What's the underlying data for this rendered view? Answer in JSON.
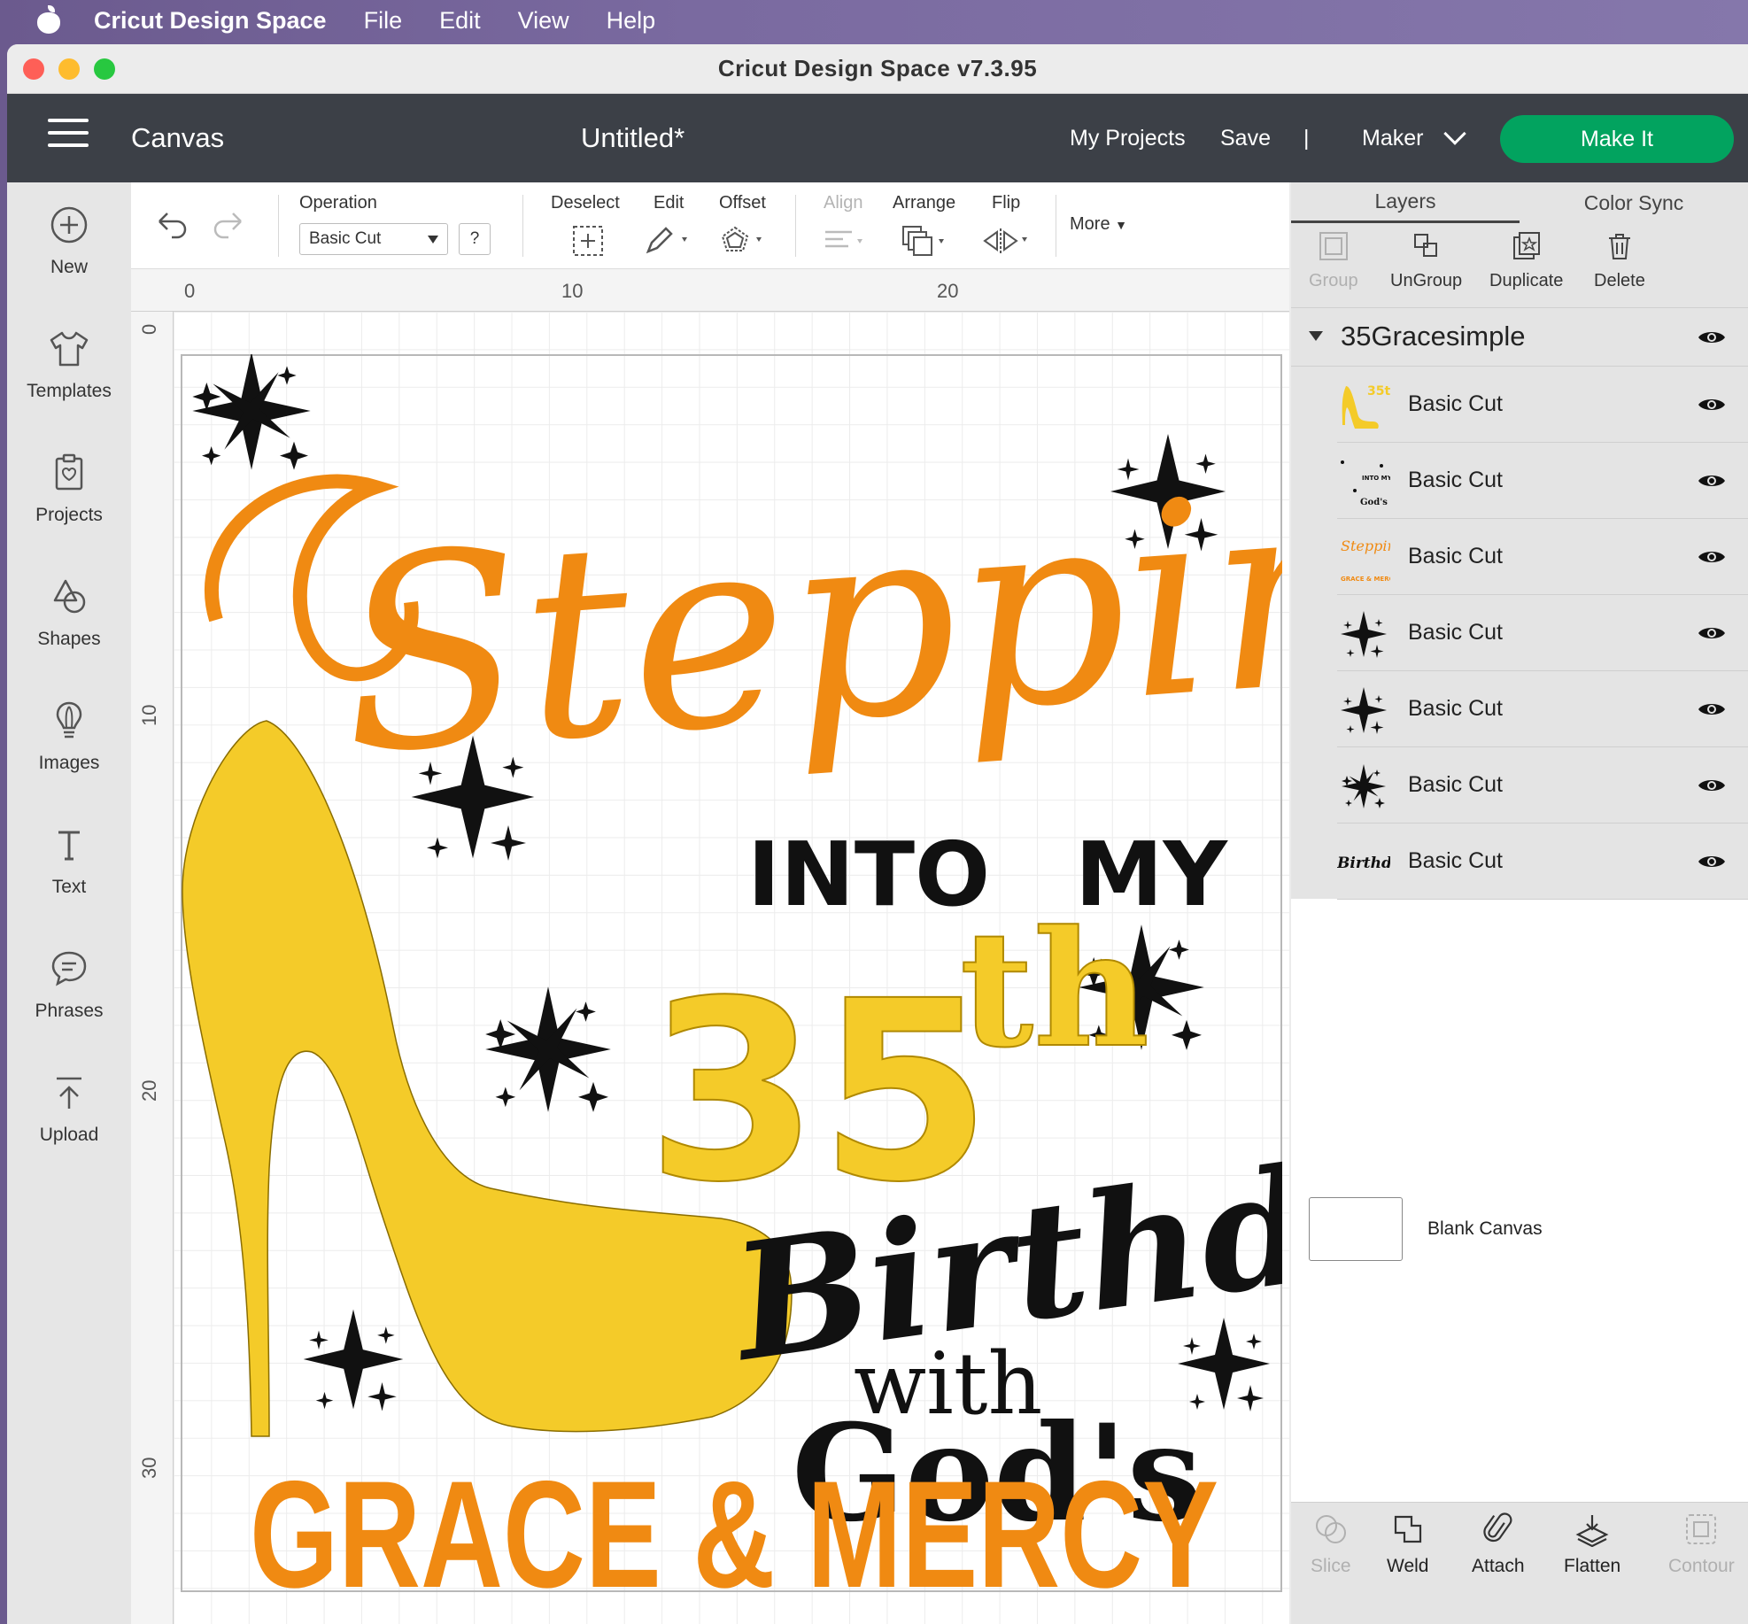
{
  "menubar": {
    "app": "Cricut Design Space",
    "items": [
      "File",
      "Edit",
      "View",
      "Help"
    ]
  },
  "window": {
    "title": "Cricut Design Space  v7.3.95"
  },
  "header": {
    "canvas": "Canvas",
    "doc_title": "Untitled*",
    "my_projects": "My Projects",
    "save": "Save",
    "divider": "|",
    "machine": "Maker",
    "make_it": "Make It"
  },
  "sidebar": {
    "items": [
      {
        "label": "New",
        "icon": "plus-circle-icon"
      },
      {
        "label": "Templates",
        "icon": "tshirt-icon"
      },
      {
        "label": "Projects",
        "icon": "projects-icon"
      },
      {
        "label": "Shapes",
        "icon": "shapes-icon"
      },
      {
        "label": "Images",
        "icon": "bulb-icon"
      },
      {
        "label": "Text",
        "icon": "text-icon"
      },
      {
        "label": "Phrases",
        "icon": "speech-bubble-icon"
      },
      {
        "label": "Upload",
        "icon": "upload-icon"
      }
    ]
  },
  "toolbar": {
    "operation_label": "Operation",
    "operation_value": "Basic Cut",
    "help": "?",
    "deselect": "Deselect",
    "edit": "Edit",
    "offset": "Offset",
    "align": "Align",
    "arrange": "Arrange",
    "flip": "Flip",
    "more": "More"
  },
  "rulers": {
    "top": [
      "0",
      "10",
      "20"
    ],
    "left": [
      "0",
      "10",
      "20",
      "30"
    ]
  },
  "design": {
    "script_word": "Stepping",
    "into": "INTO",
    "my": "MY",
    "number": "35",
    "suffix": "th",
    "birthday": "Birthday",
    "with": "with",
    "gods": "God's",
    "grace": "GRACE & MERCY",
    "colors": {
      "orange": "#f08a12",
      "yellow": "#f4cb29",
      "black": "#111111"
    }
  },
  "panel": {
    "tabs": [
      "Layers",
      "Color Sync"
    ],
    "actions": [
      "Group",
      "UnGroup",
      "Duplicate",
      "Delete"
    ],
    "group_name": "35Gracesimple",
    "layers": [
      {
        "label": "Basic Cut",
        "thumb": "shoe-35th"
      },
      {
        "label": "Basic Cut",
        "thumb": "into-my-gods"
      },
      {
        "label": "Basic Cut",
        "thumb": "stepping-grace"
      },
      {
        "label": "Basic Cut",
        "thumb": "star-burst"
      },
      {
        "label": "Basic Cut",
        "thumb": "star-burst"
      },
      {
        "label": "Basic Cut",
        "thumb": "star-burst"
      },
      {
        "label": "Basic Cut",
        "thumb": "birthday-script"
      }
    ],
    "blank_canvas": "Blank Canvas",
    "bottom_tools": [
      "Slice",
      "Weld",
      "Attach",
      "Flatten",
      "Contour"
    ]
  }
}
